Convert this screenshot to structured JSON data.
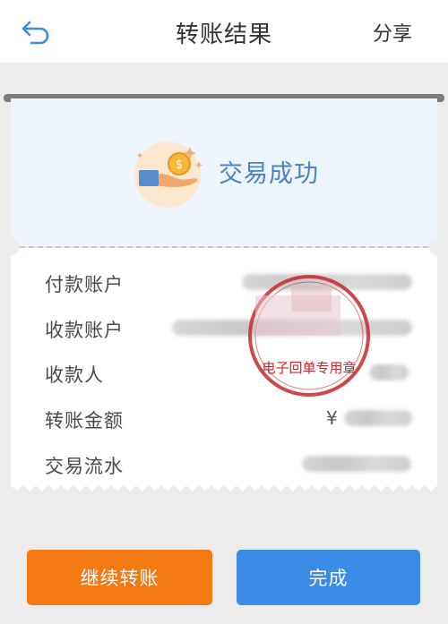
{
  "header": {
    "title": "转账结果",
    "share_label": "分享",
    "back_icon": "back-arrow-icon"
  },
  "result": {
    "status_text": "交易成功",
    "icon": "hand-coin-icon",
    "accent_color": "#4a83c4"
  },
  "details": {
    "rows": [
      {
        "label": "付款账户",
        "value": ""
      },
      {
        "label": "收款账户",
        "value": ""
      },
      {
        "label": "收款人",
        "value": ""
      },
      {
        "label": "转账金额",
        "value": "¥"
      },
      {
        "label": "交易流水",
        "value": ""
      }
    ]
  },
  "stamp": {
    "text": "电子回单专用章"
  },
  "buttons": {
    "continue_label": "继续转账",
    "done_label": "完成",
    "continue_color": "#f37a13",
    "done_color": "#3a8ce6"
  }
}
